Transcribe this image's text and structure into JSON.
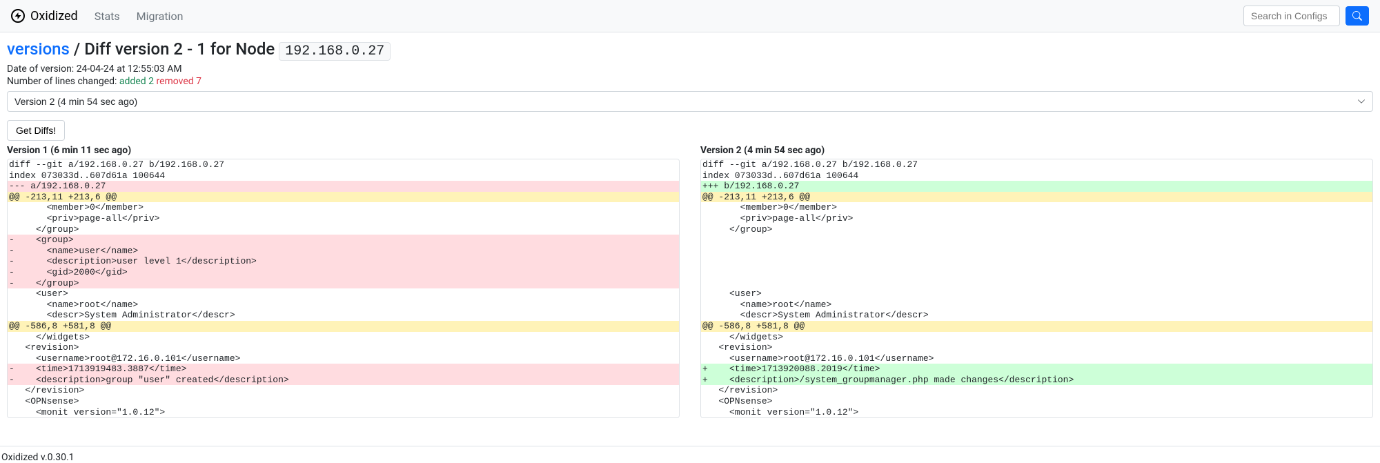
{
  "nav": {
    "brand": "Oxidized",
    "links": [
      "Stats",
      "Migration"
    ],
    "search_placeholder": "Search in Configs"
  },
  "page": {
    "versions_link": "versions",
    "separator": " / ",
    "diff_label_prefix": "Diff version 2 - 1 for Node ",
    "node": "192.168.0.27",
    "date_label": "Date of version: ",
    "date_value": "24-04-24 at 12:55:03 AM",
    "lines_label": "Number of lines changed: ",
    "added_text": "added 2",
    "removed_text": "removed 7",
    "version_select": "Version 2 (4 min 54 sec ago)",
    "get_diffs": "Get Diffs!"
  },
  "columns": {
    "left_title": "Version 1 (6 min 11 sec ago)",
    "right_title": "Version 2 (4 min 54 sec ago)"
  },
  "diff_left": [
    {
      "t": "context",
      "s": "diff --git a/192.168.0.27 b/192.168.0.27"
    },
    {
      "t": "context",
      "s": "index 073033d..607d61a 100644"
    },
    {
      "t": "header-minus",
      "s": "--- a/192.168.0.27"
    },
    {
      "t": "hunk",
      "s": "@@ -213,11 +213,6 @@"
    },
    {
      "t": "context",
      "s": "       <member>0</member>"
    },
    {
      "t": "context",
      "s": "       <priv>page-all</priv>"
    },
    {
      "t": "context",
      "s": "     </group>"
    },
    {
      "t": "removed-line",
      "s": "-    <group>"
    },
    {
      "t": "removed-line",
      "s": "-      <name>user</name>"
    },
    {
      "t": "removed-line",
      "s": "-      <description>user level 1</description>"
    },
    {
      "t": "removed-line",
      "s": "-      <gid>2000</gid>"
    },
    {
      "t": "removed-line",
      "s": "-    </group>"
    },
    {
      "t": "context",
      "s": "     <user>"
    },
    {
      "t": "context",
      "s": "       <name>root</name>"
    },
    {
      "t": "context",
      "s": "       <descr>System Administrator</descr>"
    },
    {
      "t": "hunk",
      "s": "@@ -586,8 +581,8 @@"
    },
    {
      "t": "context",
      "s": "     </widgets>"
    },
    {
      "t": "context",
      "s": "   <revision>"
    },
    {
      "t": "context",
      "s": "     <username>root@172.16.0.101</username>"
    },
    {
      "t": "removed-line",
      "s": "-    <time>1713919483.3887</time>"
    },
    {
      "t": "removed-line",
      "s": "-    <description>group \"user\" created</description>"
    },
    {
      "t": "context",
      "s": "   </revision>"
    },
    {
      "t": "context",
      "s": "   <OPNsense>"
    },
    {
      "t": "context",
      "s": "     <monit version=\"1.0.12\">"
    }
  ],
  "diff_right": [
    {
      "t": "context",
      "s": "diff --git a/192.168.0.27 b/192.168.0.27"
    },
    {
      "t": "context",
      "s": "index 073033d..607d61a 100644"
    },
    {
      "t": "header-plus",
      "s": "+++ b/192.168.0.27"
    },
    {
      "t": "hunk",
      "s": "@@ -213,11 +213,6 @@"
    },
    {
      "t": "context",
      "s": "       <member>0</member>"
    },
    {
      "t": "context",
      "s": "       <priv>page-all</priv>"
    },
    {
      "t": "context",
      "s": "     </group>"
    },
    {
      "t": "empty-space",
      "s": " "
    },
    {
      "t": "empty-space",
      "s": " "
    },
    {
      "t": "empty-space",
      "s": " "
    },
    {
      "t": "empty-space",
      "s": " "
    },
    {
      "t": "empty-space",
      "s": " "
    },
    {
      "t": "context",
      "s": "     <user>"
    },
    {
      "t": "context",
      "s": "       <name>root</name>"
    },
    {
      "t": "context",
      "s": "       <descr>System Administrator</descr>"
    },
    {
      "t": "hunk",
      "s": "@@ -586,8 +581,8 @@"
    },
    {
      "t": "context",
      "s": "     </widgets>"
    },
    {
      "t": "context",
      "s": "   <revision>"
    },
    {
      "t": "context",
      "s": "     <username>root@172.16.0.101</username>"
    },
    {
      "t": "added-line",
      "s": "+    <time>1713920088.2019</time>"
    },
    {
      "t": "added-line",
      "s": "+    <description>/system_groupmanager.php made changes</description>"
    },
    {
      "t": "context",
      "s": "   </revision>"
    },
    {
      "t": "context",
      "s": "   <OPNsense>"
    },
    {
      "t": "context",
      "s": "     <monit version=\"1.0.12\">"
    }
  ],
  "footer": "Oxidized v.0.30.1"
}
